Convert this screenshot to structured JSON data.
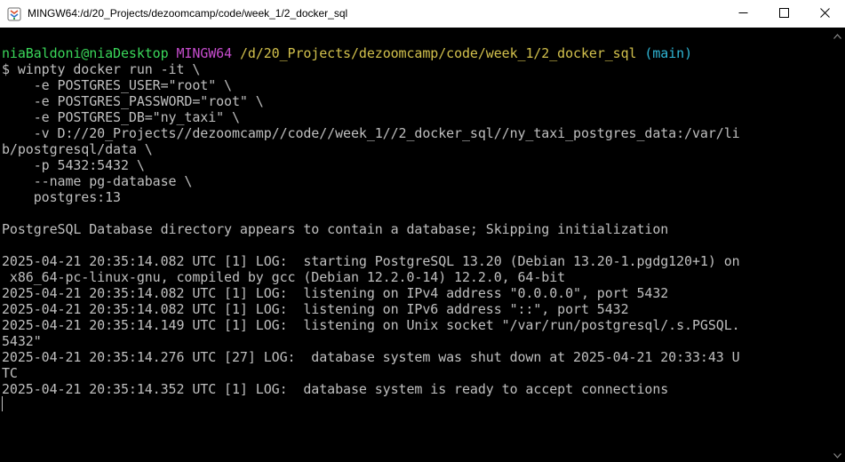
{
  "window": {
    "title": "MINGW64:/d/20_Projects/dezoomcamp/code/week_1/2_docker_sql"
  },
  "icons": {
    "app": "mingw-app-icon",
    "minimize": "minimize-icon",
    "maximize": "maximize-icon",
    "close": "close-icon",
    "scroll_up": "scroll-up-arrow-icon",
    "scroll_down": "scroll-down-arrow-icon"
  },
  "colors": {
    "background": "#000000",
    "text": "#bfbfbf",
    "prompt_user": "#3ad75a",
    "prompt_host": "#c54ccc",
    "prompt_path": "#d2c04c",
    "prompt_branch": "#2fb6d6"
  },
  "terminal": {
    "prompt": {
      "user_host": "niaBaldoni@niaDesktop",
      "system": "MINGW64",
      "path": "/d/20_Projects/dezoomcamp/code/week_1/2_docker_sql",
      "branch": "(main)"
    },
    "lines": [
      "$ winpty docker run -it \\",
      "    -e POSTGRES_USER=\"root\" \\",
      "    -e POSTGRES_PASSWORD=\"root\" \\",
      "    -e POSTGRES_DB=\"ny_taxi\" \\",
      "    -v D://20_Projects//dezoomcamp//code//week_1//2_docker_sql//ny_taxi_postgres_data:/var/li",
      "b/postgresql/data \\",
      "    -p 5432:5432 \\",
      "    --name pg-database \\",
      "    postgres:13",
      "",
      "PostgreSQL Database directory appears to contain a database; Skipping initialization",
      "",
      "2025-04-21 20:35:14.082 UTC [1] LOG:  starting PostgreSQL 13.20 (Debian 13.20-1.pgdg120+1) on",
      " x86_64-pc-linux-gnu, compiled by gcc (Debian 12.2.0-14) 12.2.0, 64-bit",
      "2025-04-21 20:35:14.082 UTC [1] LOG:  listening on IPv4 address \"0.0.0.0\", port 5432",
      "2025-04-21 20:35:14.082 UTC [1] LOG:  listening on IPv6 address \"::\", port 5432",
      "2025-04-21 20:35:14.149 UTC [1] LOG:  listening on Unix socket \"/var/run/postgresql/.s.PGSQL.",
      "5432\"",
      "2025-04-21 20:35:14.276 UTC [27] LOG:  database system was shut down at 2025-04-21 20:33:43 U",
      "TC",
      "2025-04-21 20:35:14.352 UTC [1] LOG:  database system is ready to accept connections"
    ]
  }
}
